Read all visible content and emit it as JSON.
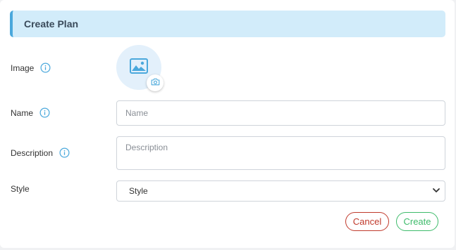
{
  "header": {
    "title": "Create Plan"
  },
  "form": {
    "image": {
      "label": "Image"
    },
    "name": {
      "label": "Name",
      "placeholder": "Name",
      "value": ""
    },
    "description": {
      "label": "Description",
      "placeholder": "Description",
      "value": ""
    },
    "style": {
      "label": "Style",
      "selected": "Style"
    }
  },
  "actions": {
    "cancel": "Cancel",
    "create": "Create"
  },
  "icons": {
    "info": "info-icon",
    "image_placeholder": "image-icon",
    "camera": "camera-icon",
    "dropdown": "chevron-down-icon"
  },
  "colors": {
    "header_bg": "#d2ecfa",
    "accent": "#4aa8dc",
    "cancel": "#c0392b",
    "create": "#3dbb6a"
  }
}
